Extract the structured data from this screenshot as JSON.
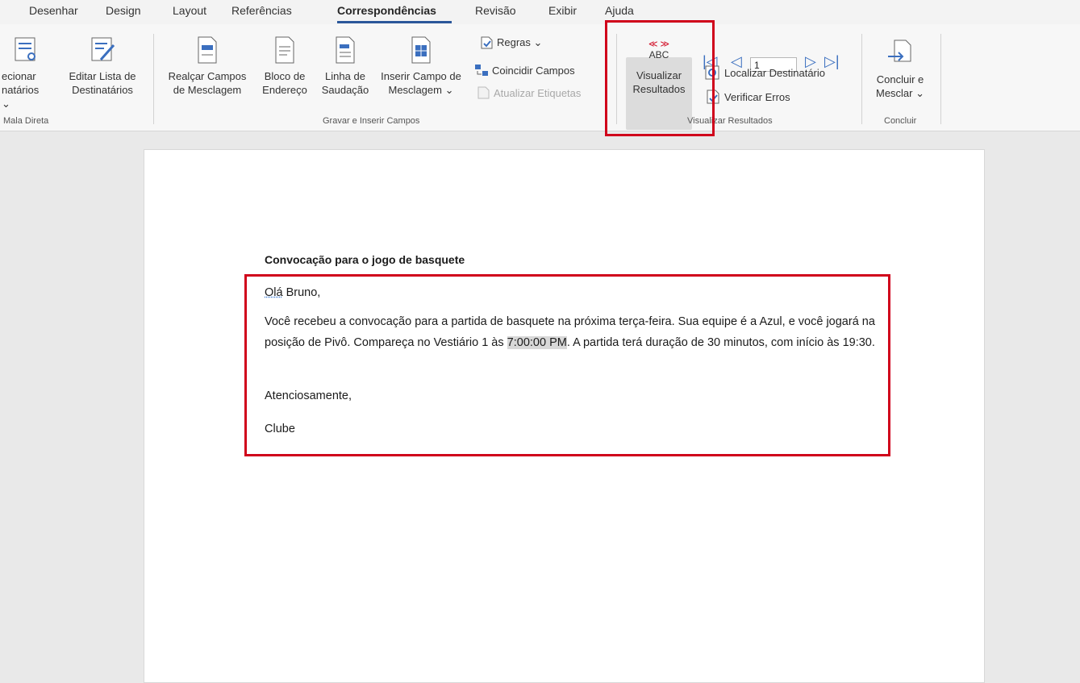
{
  "ribbon_tabs": [
    {
      "label": "Desenhar"
    },
    {
      "label": "Design"
    },
    {
      "label": "Layout"
    },
    {
      "label": "Referências"
    },
    {
      "label": "Correspondências"
    },
    {
      "label": "Revisão"
    },
    {
      "label": "Exibir"
    },
    {
      "label": "Ajuda"
    }
  ],
  "active_tab": "Correspondências",
  "groups": {
    "start": {
      "label": "Mala Direta",
      "select_recipients": {
        "line1": "ecionar",
        "line2": "natários ⌄"
      },
      "edit_list": {
        "line1": "Editar Lista de",
        "line2": "Destinatários"
      }
    },
    "write_insert": {
      "label": "Gravar e Inserir Campos",
      "highlight": {
        "line1": "Realçar Campos",
        "line2": "de Mesclagem"
      },
      "address_block": {
        "line1": "Bloco de",
        "line2": "Endereço"
      },
      "greeting_line": {
        "line1": "Linha de",
        "line2": "Saudação"
      },
      "insert_field": {
        "line1": "Inserir Campo de",
        "line2": "Mesclagem ⌄"
      },
      "rules": "Regras ⌄",
      "match_fields": "Coincidir Campos",
      "update_labels": "Atualizar Etiquetas"
    },
    "preview": {
      "label": "Visualizar Resultados",
      "preview_results": {
        "line1": "Visualizar",
        "line2": "Resultados",
        "icon_text": "ABC",
        "icon_marks": "≪ ≫"
      },
      "record_value": "1",
      "find_recipient": "Localizar Destinatário",
      "check_errors": "Verificar Erros"
    },
    "finish": {
      "label": "Concluir",
      "finish_merge": {
        "line1": "Concluir e",
        "line2": "Mesclar ⌄"
      }
    }
  },
  "document": {
    "title": "Convocação para o jogo de basquete",
    "greeting_word": "Olá",
    "greeting_rest": " Bruno,",
    "body_before": "Você recebeu a convocação para a partida de basquete na próxima terça-feira. Sua equipe é a Azul, e você jogará na posição de Pivô. Compareça no Vestiário 1 às ",
    "body_field": "7:00:00 PM",
    "body_after": ". A partida terá duração de 30 minutos, com início às 19:30.",
    "closing": "Atenciosamente,",
    "signature": "Clube"
  },
  "colors": {
    "accent": "#2b579a",
    "highlight_box": "#d0021b",
    "nav_arrows": "#3b6fbf"
  }
}
